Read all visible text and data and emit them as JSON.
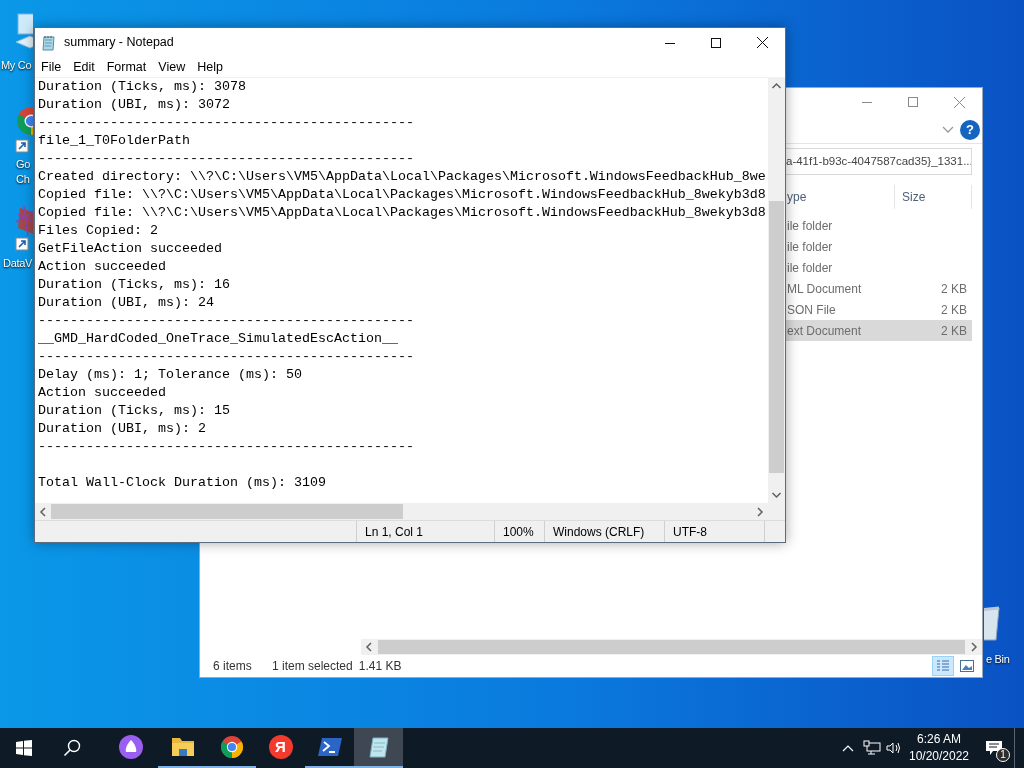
{
  "desktop_icons": [
    {
      "kind": "computer",
      "label_lines": [
        "My Co"
      ]
    },
    {
      "kind": "browser",
      "label_lines": [
        "Go",
        "Ch"
      ]
    },
    {
      "kind": "data",
      "label_lines": [
        "DataV"
      ]
    },
    {
      "kind": "recycle-bin",
      "label_lines": [
        "e Bin"
      ]
    }
  ],
  "explorer": {
    "address": "a-41f1-b93c-4047587cad35}_1331...",
    "help_glyph": "?",
    "columns": [
      "ype",
      "Size"
    ],
    "rows": [
      {
        "type": "ile folder",
        "selected": false
      },
      {
        "type": "ile folder",
        "selected": false
      },
      {
        "type": "ile folder",
        "selected": false
      },
      {
        "type": "ML Document",
        "size": "2 KB",
        "selected": false
      },
      {
        "type": "SON File",
        "size": "2 KB",
        "selected": false
      },
      {
        "type": "ext Document",
        "size": "2 KB",
        "selected": true
      }
    ],
    "status": {
      "items": "6 items",
      "selection": "1 item selected",
      "size": "1.41 KB"
    }
  },
  "notepad": {
    "title": "summary - Notepad",
    "menu": [
      "File",
      "Edit",
      "Format",
      "View",
      "Help"
    ],
    "text_blocks": [
      [
        "Duration (Ticks, ms): 3078",
        "Duration (UBI, ms): 3072",
        "-----------------------------------------------",
        "file_1_T0FolderPath",
        "-----------------------------------------------",
        "Created directory: \\\\?\\C:\\Users\\VM5\\AppData\\Local\\Packages\\Microsoft.WindowsFeedbackHub_8we",
        "Copied file: \\\\?\\C:\\Users\\VM5\\AppData\\Local\\Packages\\Microsoft.WindowsFeedbackHub_8wekyb3d8",
        "Copied file: \\\\?\\C:\\Users\\VM5\\AppData\\Local\\Packages\\Microsoft.WindowsFeedbackHub_8wekyb3d8",
        "Files Copied: 2",
        "GetFileAction succeeded",
        "Action succeeded",
        "Duration (Ticks, ms): 16",
        "Duration (UBI, ms): 24",
        "-----------------------------------------------",
        "__GMD_HardCoded_OneTrace_SimulatedEscAction__",
        "-----------------------------------------------",
        "Delay (ms): 1; Tolerance (ms): 50",
        "Action succeeded",
        "Duration (Ticks, ms): 15",
        "Duration (UBI, ms): 2",
        "-----------------------------------------------"
      ],
      [
        "Total Wall-Clock Duration (ms): 3109"
      ]
    ],
    "status_bar": [
      "Ln 1, Col 1",
      "100%",
      "Windows (CRLF)",
      "UTF-8"
    ]
  },
  "taskbar": {
    "apps": [
      {
        "kind": "assistant",
        "open": false,
        "active": false
      },
      {
        "kind": "folder",
        "open": true,
        "active": false
      },
      {
        "kind": "browser",
        "open": true,
        "active": false
      },
      {
        "kind": "letter",
        "glyph": "Я",
        "open": false,
        "active": false
      },
      {
        "kind": "terminal",
        "open": true,
        "active": false
      },
      {
        "kind": "notepad",
        "open": true,
        "active": true
      }
    ],
    "clock": {
      "time": "6:26 AM",
      "date": "10/20/2022"
    },
    "notification_count": "1"
  }
}
